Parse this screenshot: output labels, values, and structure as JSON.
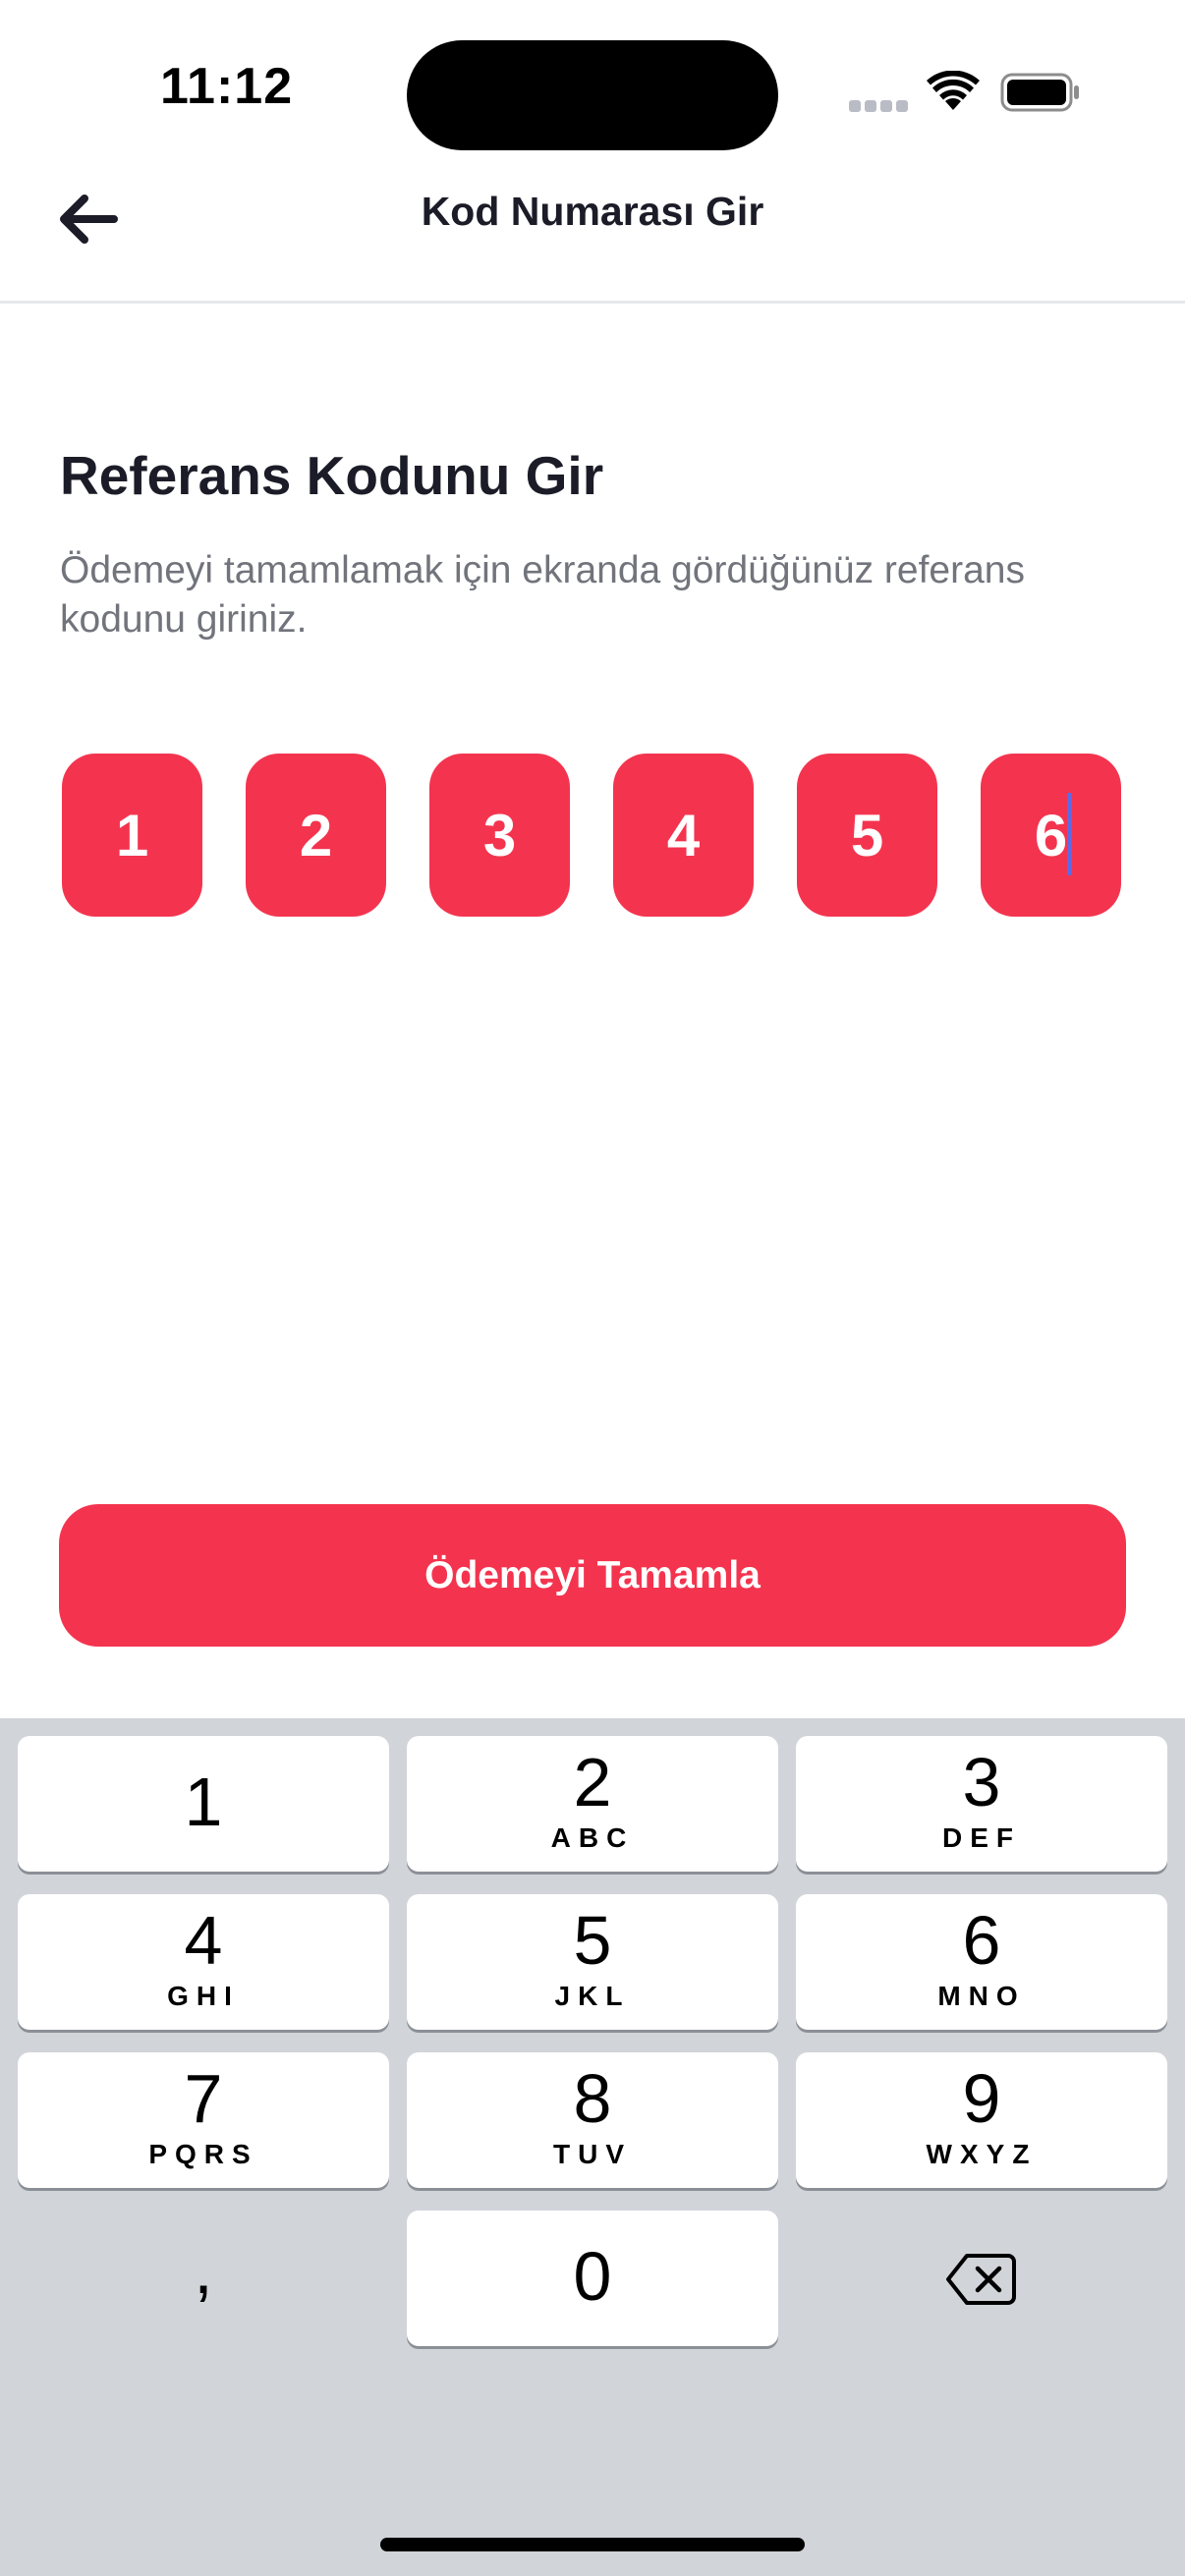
{
  "status_bar": {
    "time": "11:12"
  },
  "nav": {
    "back_icon": "arrow-left-icon",
    "title": "Kod Numarası Gir"
  },
  "content": {
    "heading": "Referans Kodunu Gir",
    "description": "Ödemeyi tamamlamak için ekranda gördüğünüz referans kodunu giriniz.",
    "code_digits": [
      "1",
      "2",
      "3",
      "4",
      "5",
      "6"
    ],
    "submit_label": "Ödemeyi Tamamla"
  },
  "keyboard": {
    "keys": [
      {
        "digit": "1",
        "letters": ""
      },
      {
        "digit": "2",
        "letters": "ABC"
      },
      {
        "digit": "3",
        "letters": "DEF"
      },
      {
        "digit": "4",
        "letters": "GHI"
      },
      {
        "digit": "5",
        "letters": "JKL"
      },
      {
        "digit": "6",
        "letters": "MNO"
      },
      {
        "digit": "7",
        "letters": "PQRS"
      },
      {
        "digit": "8",
        "letters": "TUV"
      },
      {
        "digit": "9",
        "letters": "WXYZ"
      }
    ],
    "comma": ",",
    "zero": "0",
    "delete_icon": "backspace-icon"
  },
  "colors": {
    "accent": "#f4344f",
    "keyboard_bg": "#d1d4d9",
    "caret": "#5b6be8"
  }
}
